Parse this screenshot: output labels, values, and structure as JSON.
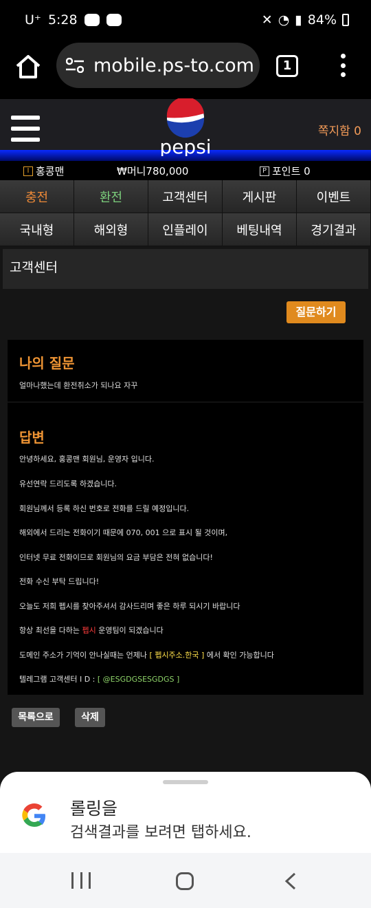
{
  "status_bar": {
    "carrier": "U⁺",
    "time": "5:28",
    "battery": "84%"
  },
  "browser": {
    "url": "mobile.ps-to.com",
    "tab_count": "1"
  },
  "site": {
    "logo_text": "pepsi",
    "message_box": "쪽지함 0",
    "user": {
      "name": "홍콩맨",
      "money_label": "₩머니780,000",
      "points_label": "포인트 0",
      "level_icon": "I",
      "points_icon": "P"
    }
  },
  "menu": {
    "row1": [
      "충전",
      "환전",
      "고객센터",
      "게시판",
      "이벤트"
    ],
    "row2": [
      "국내형",
      "해외형",
      "인플레이",
      "베팅내역",
      "경기결과"
    ]
  },
  "page": {
    "title": "고객센터",
    "ask_button": "질문하기",
    "question_title": "나의 질문",
    "question_text": "얼마나했는데 환전취소가 되나요 자꾸",
    "answer_title": "답변",
    "answers": [
      "안녕하세요, 홍콩맨 회원님, 운영자 입니다.",
      "유선연락 드리도록 하겠습니다.",
      "회원님께서 등록 하신 번호로 전화를 드릴 예정입니다.",
      "해외에서 드리는 전화이기 때문에 070, 001 으로 표시 될 것이며,",
      "인터넷 무료 전화이므로 회원님의 요금 부담은 전혀 없습니다!",
      "전화 수신 부탁 드립니다!",
      "오늘도 저희 펩시를 찾아주셔서 감사드리며 좋은 하루 되시기 바랍니다"
    ],
    "answer_8_pre": "항상 최선을 다하는 ",
    "answer_8_red": "펩시",
    "answer_8_post": " 운영팀이 되겠습니다",
    "answer_9_pre": "도메인 주소가 기억이 안나실때는 언제나 ",
    "answer_9_yellow": "[ 펩시주소.한국 ]",
    "answer_9_post": " 에서 확인 가능합니다",
    "answer_10_pre": "텔레그램 고객센터 I D : ",
    "answer_10_green": "[ @ESGDGSESGDGS ]",
    "list_button": "목록으로",
    "delete_button": "삭제"
  },
  "google_sheet": {
    "title": "롤링을",
    "subtitle": "검색결과를 보려면 탭하세요."
  },
  "colors": {
    "accent": "#f09534",
    "header_blue": "#0a2aff",
    "ask_button": "#e08a1e"
  }
}
